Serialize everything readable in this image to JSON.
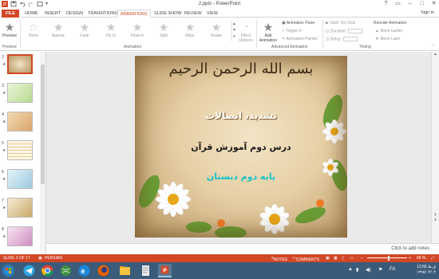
{
  "window": {
    "title": "2.pptx - PowerPoint",
    "sign_in": "Sign in"
  },
  "tabs": [
    "FILE",
    "HOME",
    "INSERT",
    "DESIGN",
    "TRANSITIONS",
    "ANIMATIONS",
    "SLIDE SHOW",
    "REVIEW",
    "VIEW"
  ],
  "ribbon": {
    "preview_label": "Preview",
    "effects": [
      "None",
      "Appear",
      "Fade",
      "Fly In",
      "Float In",
      "Split",
      "Wipe",
      "Shape"
    ],
    "effect_options": "Effect Options",
    "add_animation": "Add Animation",
    "animation_pane": "Animation Pane",
    "trigger": "Trigger",
    "animation_painter": "Animation Painter",
    "start": "Start:",
    "start_value": "On Click",
    "duration": "Duration:",
    "delay": "Delay:",
    "reorder_animation": "Reorder Animation",
    "move_earlier": "▲ Move Earlier",
    "move_later": "▼ Move Later",
    "groups": {
      "preview": "Preview",
      "animation": "Animation",
      "advanced": "Advanced Animation",
      "timing": "Timing"
    }
  },
  "thumbnails": [
    {
      "num": "2",
      "selected": true
    },
    {
      "num": "3",
      "selected": false
    },
    {
      "num": "4",
      "selected": false
    },
    {
      "num": "5",
      "selected": false
    },
    {
      "num": "6",
      "selected": false
    },
    {
      "num": "7",
      "selected": false
    },
    {
      "num": "8",
      "selected": false
    }
  ],
  "slide": {
    "calligraphy": "بسم الله الرحمن الرحیم",
    "line1": "تشدید، اتصالات",
    "line2": "درس دوم آموزش قرآن",
    "line3": "پایه دوم دبستان"
  },
  "notes_placeholder": "Click to add notes",
  "status": {
    "slide_info": "SLIDE 2 OF 17",
    "language": "PERSIAN",
    "notes": "NOTES",
    "comments": "COMMENTS",
    "zoom": "69 %"
  },
  "taskbar": {
    "time": "12:55 ق.ظ",
    "date": "۱۳۹۷/۰۴/۰۴",
    "lang": "FA"
  },
  "colors": {
    "accent": "#d24726",
    "taskbar": "#3b5b7a",
    "teal_text": "#16c3c9"
  }
}
